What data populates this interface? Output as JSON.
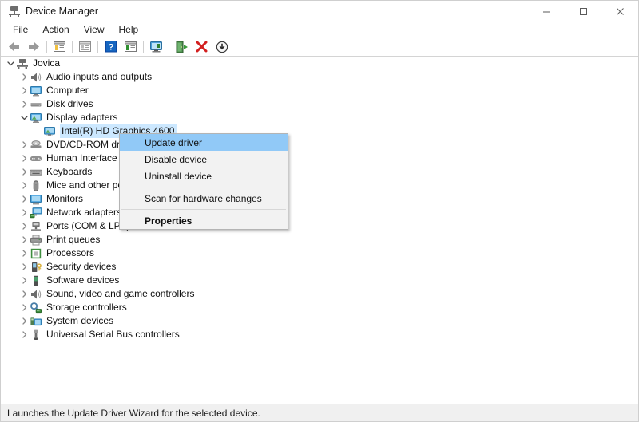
{
  "window": {
    "title": "Device Manager",
    "title_icon": "device-manager-icon",
    "controls": [
      {
        "name": "minimize-button",
        "glyph": "minimize-icon"
      },
      {
        "name": "maximize-button",
        "glyph": "maximize-icon"
      },
      {
        "name": "close-button",
        "glyph": "close-icon"
      }
    ]
  },
  "menubar": {
    "items": [
      {
        "label": "File"
      },
      {
        "label": "Action"
      },
      {
        "label": "View"
      },
      {
        "label": "Help"
      }
    ]
  },
  "toolbar": {
    "buttons": [
      {
        "name": "back-button",
        "icon": "back-arrow-icon"
      },
      {
        "name": "forward-button",
        "icon": "forward-arrow-icon"
      },
      {
        "name": "separator-1",
        "icon": "separator"
      },
      {
        "name": "show-hide-console-tree-button",
        "icon": "console-tree-icon"
      },
      {
        "name": "separator-2",
        "icon": "separator"
      },
      {
        "name": "properties-button",
        "icon": "properties-window-icon"
      },
      {
        "name": "separator-3",
        "icon": "separator"
      },
      {
        "name": "help-button",
        "icon": "help-question-icon"
      },
      {
        "name": "view-button",
        "icon": "view-list-icon"
      },
      {
        "name": "separator-4",
        "icon": "separator"
      },
      {
        "name": "scan-for-hardware-changes-button",
        "icon": "scan-monitor-icon"
      },
      {
        "name": "separator-5",
        "icon": "separator"
      },
      {
        "name": "update-driver-button",
        "icon": "update-driver-icon"
      },
      {
        "name": "uninstall-device-button",
        "icon": "red-x-icon"
      },
      {
        "name": "disable-device-button",
        "icon": "down-arrow-circle-icon"
      }
    ]
  },
  "tree": {
    "root": {
      "label": "Jovica",
      "icon": "computer-root-icon",
      "expanded": true,
      "twisty": "chevron-down-icon"
    },
    "items": [
      {
        "label": "Audio inputs and outputs",
        "icon": "speaker-icon",
        "expanded": false,
        "twisty": "chevron-right-icon",
        "selected": false,
        "indent": 1
      },
      {
        "label": "Computer",
        "icon": "monitor-icon",
        "expanded": false,
        "twisty": "chevron-right-icon",
        "selected": false,
        "indent": 1
      },
      {
        "label": "Disk drives",
        "icon": "disk-drive-icon",
        "expanded": false,
        "twisty": "chevron-right-icon",
        "selected": false,
        "indent": 1
      },
      {
        "label": "Display adapters",
        "icon": "display-adapter-icon",
        "expanded": true,
        "twisty": "chevron-down-icon",
        "selected": false,
        "indent": 1
      },
      {
        "label": "Intel(R) HD Graphics 4600",
        "icon": "display-adapter-icon",
        "expanded": false,
        "twisty": "none",
        "selected": true,
        "indent": 2
      },
      {
        "label": "DVD/CD-ROM drives",
        "icon": "dvd-drive-icon",
        "expanded": false,
        "twisty": "chevron-right-icon",
        "selected": false,
        "indent": 1
      },
      {
        "label": "Human Interface Devices",
        "icon": "hid-icon",
        "expanded": false,
        "twisty": "chevron-right-icon",
        "selected": false,
        "indent": 1
      },
      {
        "label": "Keyboards",
        "icon": "keyboard-icon",
        "expanded": false,
        "twisty": "chevron-right-icon",
        "selected": false,
        "indent": 1
      },
      {
        "label": "Mice and other pointing devices",
        "icon": "mouse-icon",
        "expanded": false,
        "twisty": "chevron-right-icon",
        "selected": false,
        "indent": 1
      },
      {
        "label": "Monitors",
        "icon": "monitor-icon",
        "expanded": false,
        "twisty": "chevron-right-icon",
        "selected": false,
        "indent": 1
      },
      {
        "label": "Network adapters",
        "icon": "network-adapter-icon",
        "expanded": false,
        "twisty": "chevron-right-icon",
        "selected": false,
        "indent": 1
      },
      {
        "label": "Ports (COM & LPT)",
        "icon": "port-icon",
        "expanded": false,
        "twisty": "chevron-right-icon",
        "selected": false,
        "indent": 1
      },
      {
        "label": "Print queues",
        "icon": "printer-icon",
        "expanded": false,
        "twisty": "chevron-right-icon",
        "selected": false,
        "indent": 1
      },
      {
        "label": "Processors",
        "icon": "processor-icon",
        "expanded": false,
        "twisty": "chevron-right-icon",
        "selected": false,
        "indent": 1
      },
      {
        "label": "Security devices",
        "icon": "security-device-icon",
        "expanded": false,
        "twisty": "chevron-right-icon",
        "selected": false,
        "indent": 1
      },
      {
        "label": "Software devices",
        "icon": "software-device-icon",
        "expanded": false,
        "twisty": "chevron-right-icon",
        "selected": false,
        "indent": 1
      },
      {
        "label": "Sound, video and game controllers",
        "icon": "speaker-icon",
        "expanded": false,
        "twisty": "chevron-right-icon",
        "selected": false,
        "indent": 1
      },
      {
        "label": "Storage controllers",
        "icon": "storage-controller-icon",
        "expanded": false,
        "twisty": "chevron-right-icon",
        "selected": false,
        "indent": 1
      },
      {
        "label": "System devices",
        "icon": "system-device-icon",
        "expanded": false,
        "twisty": "chevron-right-icon",
        "selected": false,
        "indent": 1
      },
      {
        "label": "Universal Serial Bus controllers",
        "icon": "usb-icon",
        "expanded": false,
        "twisty": "chevron-right-icon",
        "selected": false,
        "indent": 1
      }
    ]
  },
  "context_menu": {
    "items": [
      {
        "label": "Update driver",
        "highlighted": true,
        "bold": false,
        "type": "item"
      },
      {
        "label": "Disable device",
        "highlighted": false,
        "bold": false,
        "type": "item"
      },
      {
        "label": "Uninstall device",
        "highlighted": false,
        "bold": false,
        "type": "item"
      },
      {
        "label": "",
        "type": "separator"
      },
      {
        "label": "Scan for hardware changes",
        "highlighted": false,
        "bold": false,
        "type": "item"
      },
      {
        "label": "",
        "type": "separator"
      },
      {
        "label": "Properties",
        "highlighted": false,
        "bold": true,
        "type": "item"
      }
    ]
  },
  "statusbar": {
    "text": "Launches the Update Driver Wizard for the selected device."
  },
  "colors": {
    "selection": "#cce8ff",
    "menu_highlight": "#91c9f7",
    "menu_bg": "#f2f2f2",
    "statusbar_bg": "#f0f0f0",
    "window_bg": "#ffffff"
  }
}
